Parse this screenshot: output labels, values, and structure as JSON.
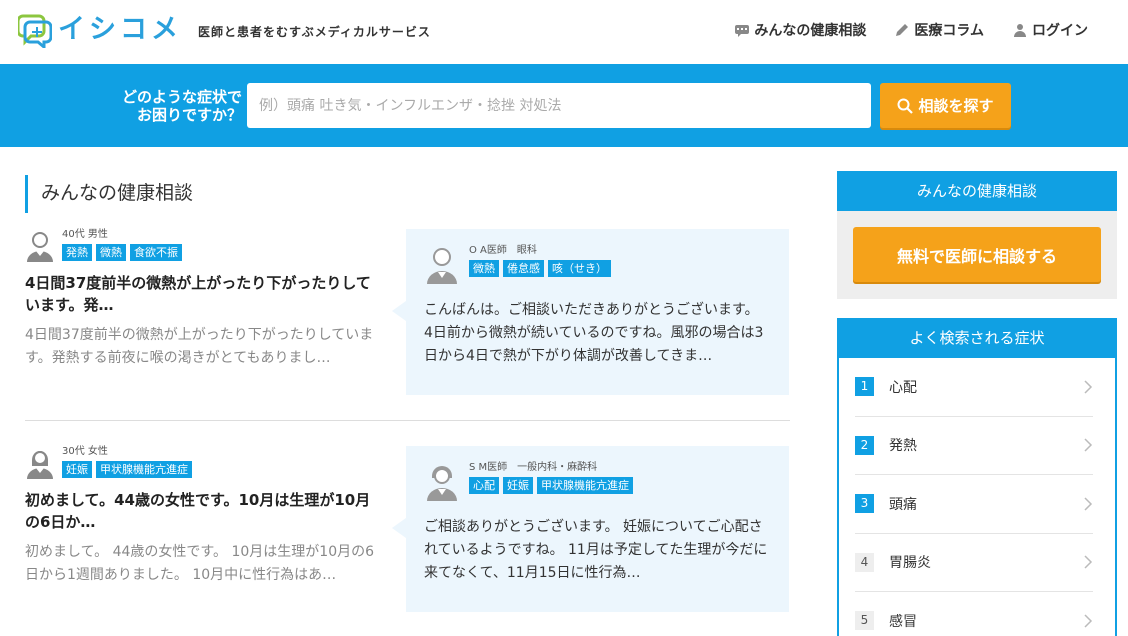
{
  "header": {
    "logo_text": "イシコメ",
    "tagline": "医師と患者をむすぶメディカルサービス",
    "nav": [
      {
        "label": "みんなの健康相談",
        "icon": "chat-icon"
      },
      {
        "label": "医療コラム",
        "icon": "pencil-icon"
      },
      {
        "label": "ログイン",
        "icon": "user-icon"
      }
    ]
  },
  "search": {
    "question_line1": "どのような症状で",
    "question_line2": "お困りですか？",
    "placeholder": "例）頭痛 吐き気・インフルエンザ・捻挫 対処法",
    "button_label": "相談を探す"
  },
  "main": {
    "section_title": "みんなの健康相談",
    "questions": [
      {
        "meta": "40代 男性",
        "tags": [
          "発熱",
          "微熱",
          "食欲不振"
        ],
        "title": "4日間37度前半の微熱が上がったり下がったりしています。発…",
        "body": "4日間37度前半の微熱が上がったり下がったりしています。発熱する前夜に喉の渇きがとてもありまし…",
        "answer": {
          "doctor": "O A医師　眼科",
          "tags": [
            "微熱",
            "倦怠感",
            "咳（せき）"
          ],
          "text": "こんばんは。ご相談いただきありがとうございます。 4日前から微熱が続いているのですね。風邪の場合は3日から4日で熱が下がり体調が改善してきま…"
        }
      },
      {
        "meta": "30代 女性",
        "tags": [
          "妊娠",
          "甲状腺機能亢進症"
        ],
        "title": "初めまして。44歳の女性です。10月は生理が10月の6日か…",
        "body": "初めまして。 44歳の女性です。 10月は生理が10月の6日から1週間ありました。 10月中に性行為はあ…",
        "answer": {
          "doctor": "S M医師　一般内科・麻酔科",
          "tags": [
            "心配",
            "妊娠",
            "甲状腺機能亢進症"
          ],
          "text": "ご相談ありがとうございます。 妊娠についてご心配されているようですね。 11月は予定してた生理が今だに来てなくて、11月15日に性行為…"
        }
      }
    ]
  },
  "sidebar": {
    "box1_title": "みんなの健康相談",
    "consult_button": "無料で医師に相談する",
    "box2_title": "よく検索される症状",
    "ranking": [
      {
        "num": "1",
        "label": "心配"
      },
      {
        "num": "2",
        "label": "発熱"
      },
      {
        "num": "3",
        "label": "頭痛"
      },
      {
        "num": "4",
        "label": "胃腸炎"
      },
      {
        "num": "5",
        "label": "感冒"
      }
    ]
  },
  "colors": {
    "accent": "#10a0e3",
    "orange": "#f5a21a"
  }
}
